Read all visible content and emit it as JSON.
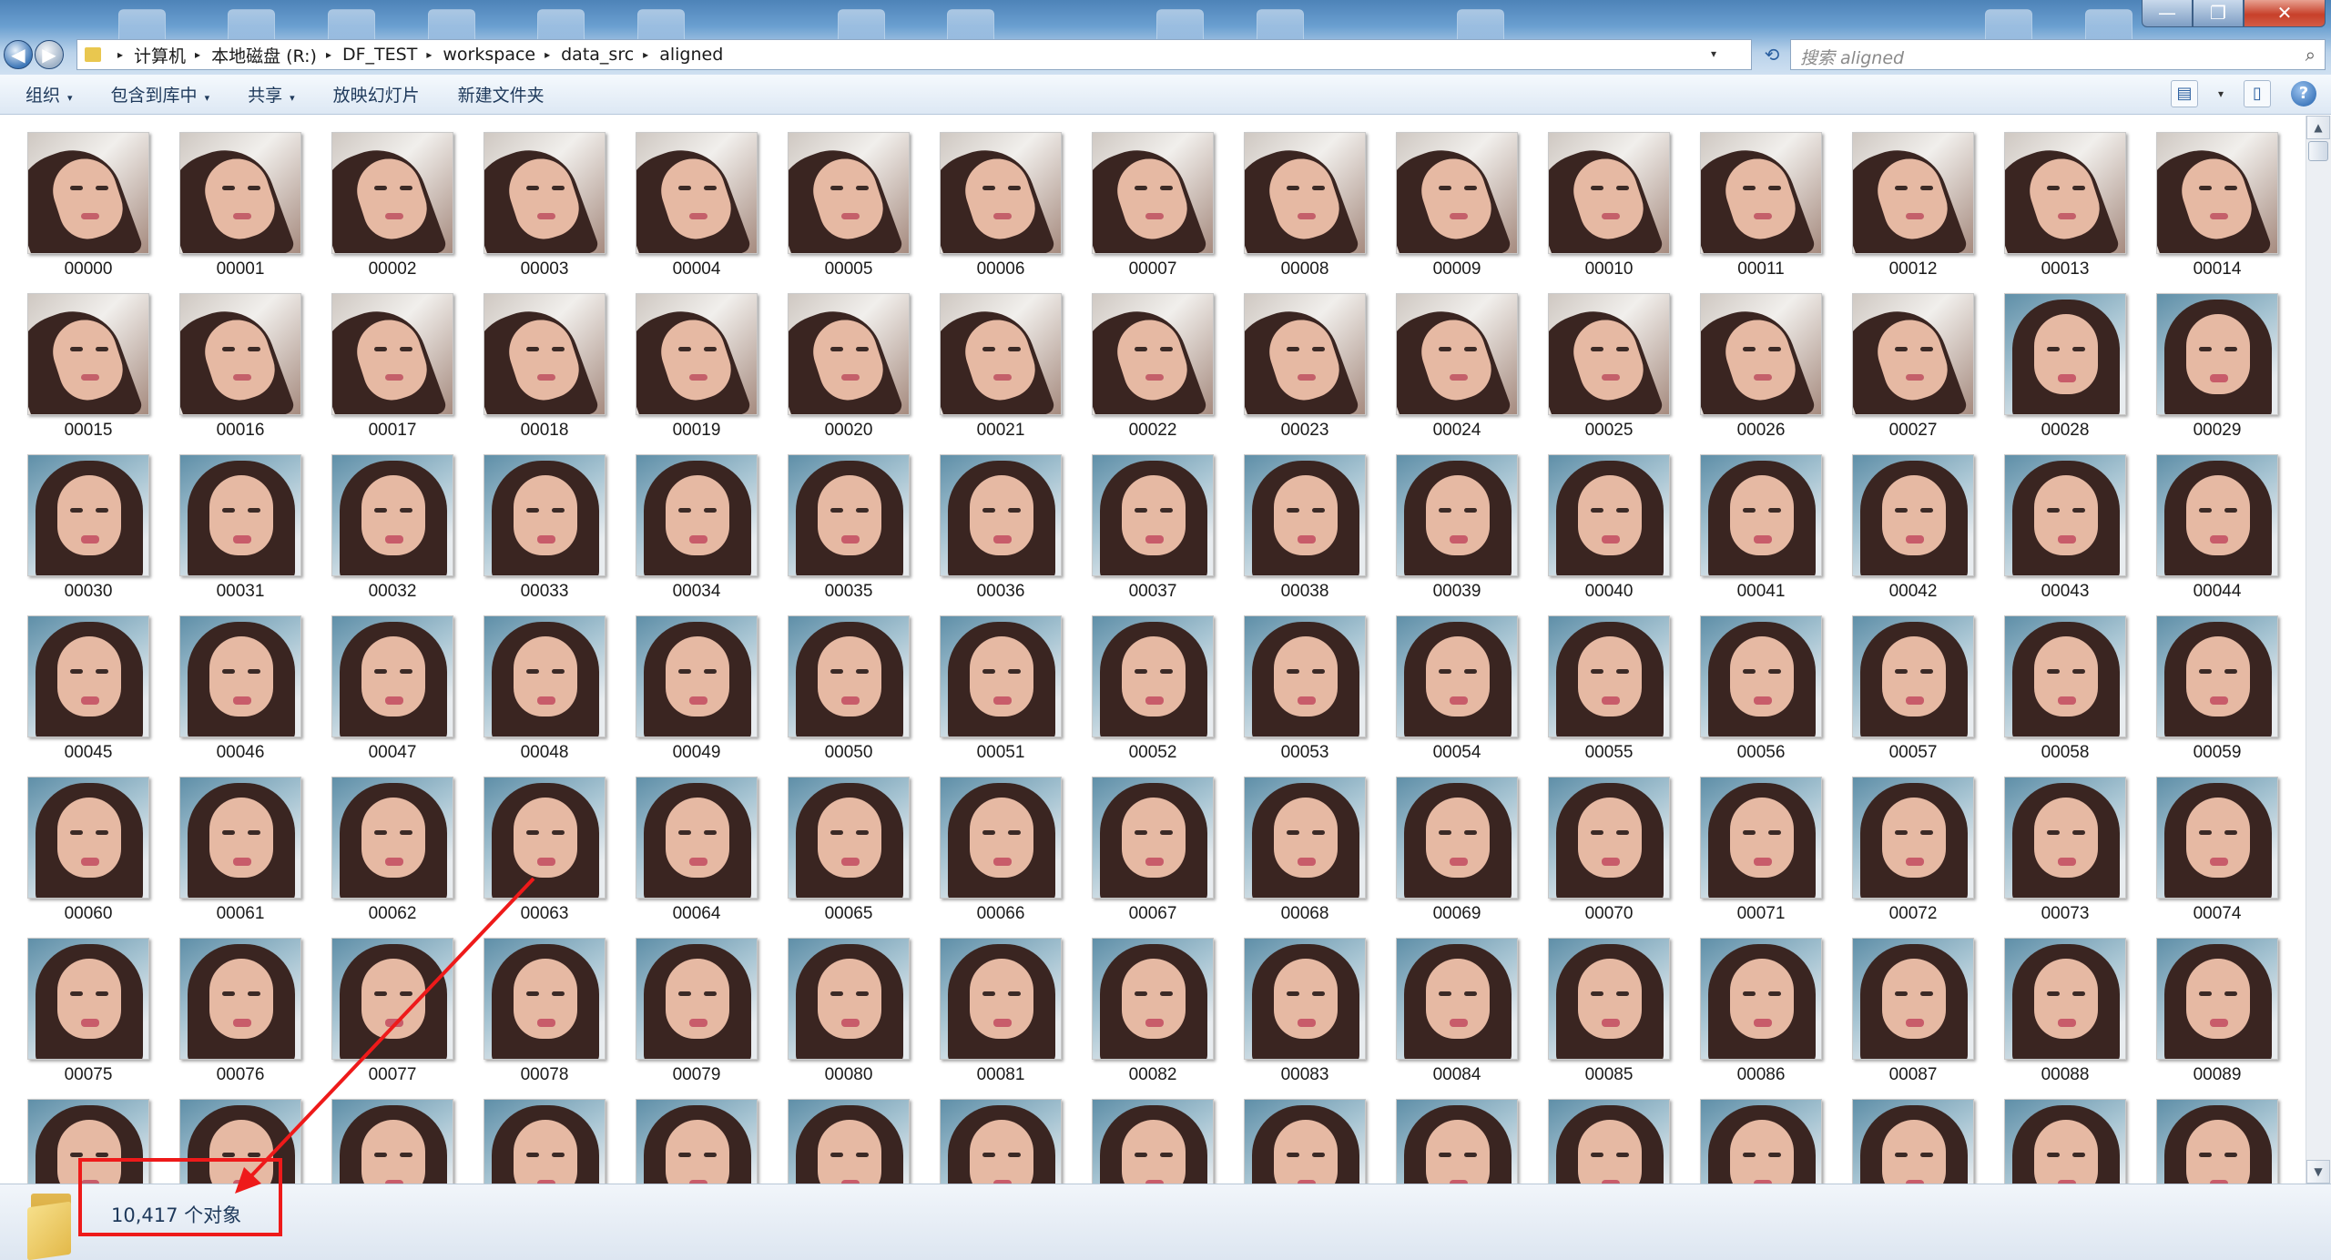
{
  "window": {
    "minimize_glyph": "—",
    "maximize_glyph": "❐",
    "close_glyph": "✕"
  },
  "navigation": {
    "back_glyph": "◀",
    "forward_glyph": "▶",
    "breadcrumb": [
      "计算机",
      "本地磁盘 (R:)",
      "DF_TEST",
      "workspace",
      "data_src",
      "aligned"
    ],
    "refresh_glyph": "⟲",
    "search_placeholder": "搜索 aligned",
    "search_icon_glyph": "⌕"
  },
  "toolbar": {
    "organize": "组织",
    "include_in_library": "包含到库中",
    "share": "共享",
    "slideshow": "放映幻灯片",
    "new_folder": "新建文件夹",
    "dropdown_glyph": "▾",
    "view_glyph": "▤",
    "preview_pane_glyph": "▯",
    "help_glyph": "?"
  },
  "files": [
    {
      "name": "00000",
      "kind": "sleep"
    },
    {
      "name": "00001",
      "kind": "sleep"
    },
    {
      "name": "00002",
      "kind": "sleep"
    },
    {
      "name": "00003",
      "kind": "sleep"
    },
    {
      "name": "00004",
      "kind": "sleep"
    },
    {
      "name": "00005",
      "kind": "sleep"
    },
    {
      "name": "00006",
      "kind": "sleep"
    },
    {
      "name": "00007",
      "kind": "sleep"
    },
    {
      "name": "00008",
      "kind": "sleep"
    },
    {
      "name": "00009",
      "kind": "sleep"
    },
    {
      "name": "00010",
      "kind": "sleep"
    },
    {
      "name": "00011",
      "kind": "sleep"
    },
    {
      "name": "00012",
      "kind": "sleep"
    },
    {
      "name": "00013",
      "kind": "sleep"
    },
    {
      "name": "00014",
      "kind": "sleep"
    },
    {
      "name": "00015",
      "kind": "sleep"
    },
    {
      "name": "00016",
      "kind": "sleep"
    },
    {
      "name": "00017",
      "kind": "sleep"
    },
    {
      "name": "00018",
      "kind": "sleep"
    },
    {
      "name": "00019",
      "kind": "sleep"
    },
    {
      "name": "00020",
      "kind": "sleep"
    },
    {
      "name": "00021",
      "kind": "sleep"
    },
    {
      "name": "00022",
      "kind": "sleep"
    },
    {
      "name": "00023",
      "kind": "sleep"
    },
    {
      "name": "00024",
      "kind": "sleep"
    },
    {
      "name": "00025",
      "kind": "sleep"
    },
    {
      "name": "00026",
      "kind": "sleep"
    },
    {
      "name": "00027",
      "kind": "sleep"
    },
    {
      "name": "00028",
      "kind": "smile"
    },
    {
      "name": "00029",
      "kind": "smile"
    },
    {
      "name": "00030",
      "kind": "smile"
    },
    {
      "name": "00031",
      "kind": "smile"
    },
    {
      "name": "00032",
      "kind": "smile"
    },
    {
      "name": "00033",
      "kind": "smile"
    },
    {
      "name": "00034",
      "kind": "smile"
    },
    {
      "name": "00035",
      "kind": "smile"
    },
    {
      "name": "00036",
      "kind": "smile"
    },
    {
      "name": "00037",
      "kind": "smile"
    },
    {
      "name": "00038",
      "kind": "smile"
    },
    {
      "name": "00039",
      "kind": "smile"
    },
    {
      "name": "00040",
      "kind": "smile"
    },
    {
      "name": "00041",
      "kind": "smile"
    },
    {
      "name": "00042",
      "kind": "smile"
    },
    {
      "name": "00043",
      "kind": "smile"
    },
    {
      "name": "00044",
      "kind": "smile"
    },
    {
      "name": "00045",
      "kind": "smile"
    },
    {
      "name": "00046",
      "kind": "smile"
    },
    {
      "name": "00047",
      "kind": "smile"
    },
    {
      "name": "00048",
      "kind": "smile"
    },
    {
      "name": "00049",
      "kind": "smile"
    },
    {
      "name": "00050",
      "kind": "smile"
    },
    {
      "name": "00051",
      "kind": "smile"
    },
    {
      "name": "00052",
      "kind": "smile"
    },
    {
      "name": "00053",
      "kind": "smile"
    },
    {
      "name": "00054",
      "kind": "smile"
    },
    {
      "name": "00055",
      "kind": "smile"
    },
    {
      "name": "00056",
      "kind": "smile"
    },
    {
      "name": "00057",
      "kind": "smile"
    },
    {
      "name": "00058",
      "kind": "smile"
    },
    {
      "name": "00059",
      "kind": "smile"
    },
    {
      "name": "00060",
      "kind": "smile"
    },
    {
      "name": "00061",
      "kind": "smile"
    },
    {
      "name": "00062",
      "kind": "smile"
    },
    {
      "name": "00063",
      "kind": "smile"
    },
    {
      "name": "00064",
      "kind": "smile"
    },
    {
      "name": "00065",
      "kind": "smile"
    },
    {
      "name": "00066",
      "kind": "smile"
    },
    {
      "name": "00067",
      "kind": "smile"
    },
    {
      "name": "00068",
      "kind": "smile"
    },
    {
      "name": "00069",
      "kind": "smile"
    },
    {
      "name": "00070",
      "kind": "smile"
    },
    {
      "name": "00071",
      "kind": "smile"
    },
    {
      "name": "00072",
      "kind": "smile"
    },
    {
      "name": "00073",
      "kind": "smile"
    },
    {
      "name": "00074",
      "kind": "smile"
    },
    {
      "name": "00075",
      "kind": "smile"
    },
    {
      "name": "00076",
      "kind": "smile"
    },
    {
      "name": "00077",
      "kind": "smile"
    },
    {
      "name": "00078",
      "kind": "smile"
    },
    {
      "name": "00079",
      "kind": "smile"
    },
    {
      "name": "00080",
      "kind": "smile"
    },
    {
      "name": "00081",
      "kind": "smile"
    },
    {
      "name": "00082",
      "kind": "smile"
    },
    {
      "name": "00083",
      "kind": "smile"
    },
    {
      "name": "00084",
      "kind": "smile"
    },
    {
      "name": "00085",
      "kind": "smile"
    },
    {
      "name": "00086",
      "kind": "smile"
    },
    {
      "name": "00087",
      "kind": "smile"
    },
    {
      "name": "00088",
      "kind": "smile"
    },
    {
      "name": "00089",
      "kind": "smile"
    },
    {
      "name": "",
      "kind": "smile"
    },
    {
      "name": "",
      "kind": "smile"
    },
    {
      "name": "",
      "kind": "smile"
    },
    {
      "name": "",
      "kind": "smile"
    },
    {
      "name": "",
      "kind": "smile"
    },
    {
      "name": "",
      "kind": "smile"
    },
    {
      "name": "",
      "kind": "smile"
    },
    {
      "name": "",
      "kind": "smile"
    },
    {
      "name": "",
      "kind": "smile"
    },
    {
      "name": "",
      "kind": "smile"
    },
    {
      "name": "",
      "kind": "smile"
    },
    {
      "name": "",
      "kind": "smile"
    },
    {
      "name": "",
      "kind": "smile"
    },
    {
      "name": "",
      "kind": "smile"
    },
    {
      "name": "",
      "kind": "smile"
    }
  ],
  "scrollbar": {
    "up_glyph": "▲",
    "down_glyph": "▼"
  },
  "status": {
    "object_count": "10,417 个对象"
  },
  "colors": {
    "annotation_red": "#ee1a1a",
    "accent_blue": "#1e395b"
  }
}
